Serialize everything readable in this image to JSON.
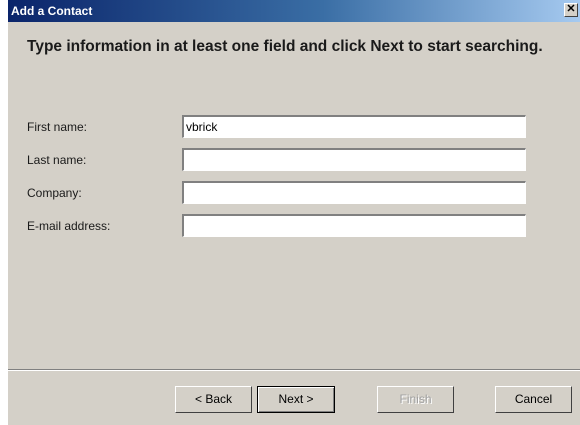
{
  "dialog": {
    "title": "Add a Contact",
    "close_glyph": "✕",
    "heading": "Type information in at least one field and click Next to start searching."
  },
  "fields": [
    {
      "label": "First name:",
      "value": "vbrick"
    },
    {
      "label": "Last name:",
      "value": ""
    },
    {
      "label": "Company:",
      "value": ""
    },
    {
      "label": "E-mail address:",
      "value": ""
    }
  ],
  "buttons": {
    "back": "< Back",
    "next": "Next >",
    "finish": "Finish",
    "cancel": "Cancel"
  }
}
